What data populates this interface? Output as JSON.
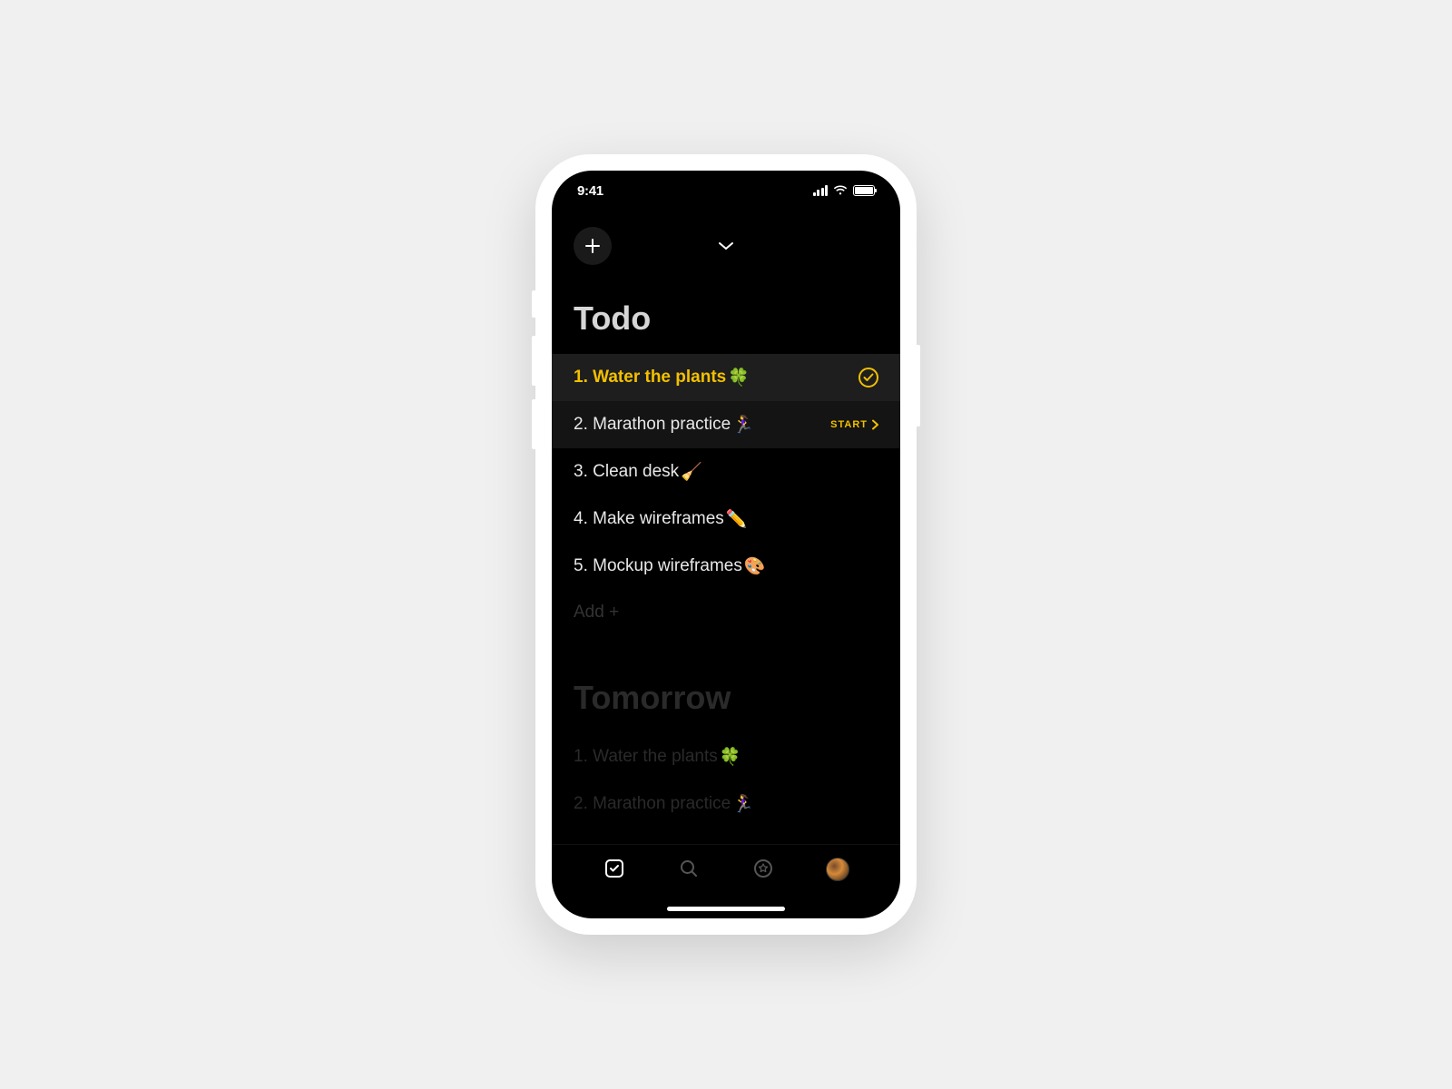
{
  "statusBar": {
    "time": "9:41"
  },
  "sections": {
    "todo": {
      "title": "Todo",
      "items": [
        {
          "text": "1. Water the plants",
          "emoji": "🍀"
        },
        {
          "text": "2. Marathon practice",
          "emoji": "🏃‍♀️",
          "start_label": "START"
        },
        {
          "text": "3. Clean desk",
          "emoji": "🧹"
        },
        {
          "text": "4. Make wireframes",
          "emoji": "✏️"
        },
        {
          "text": "5. Mockup wireframes",
          "emoji": "🎨"
        }
      ],
      "add_label": "Add +"
    },
    "tomorrow": {
      "title": "Tomorrow",
      "items": [
        {
          "text": "1. Water the plants",
          "emoji": "🍀"
        },
        {
          "text": "2. Marathon practice",
          "emoji": "🏃‍♀️"
        }
      ]
    }
  },
  "colors": {
    "accent": "#f2c000",
    "bg": "#000000"
  }
}
